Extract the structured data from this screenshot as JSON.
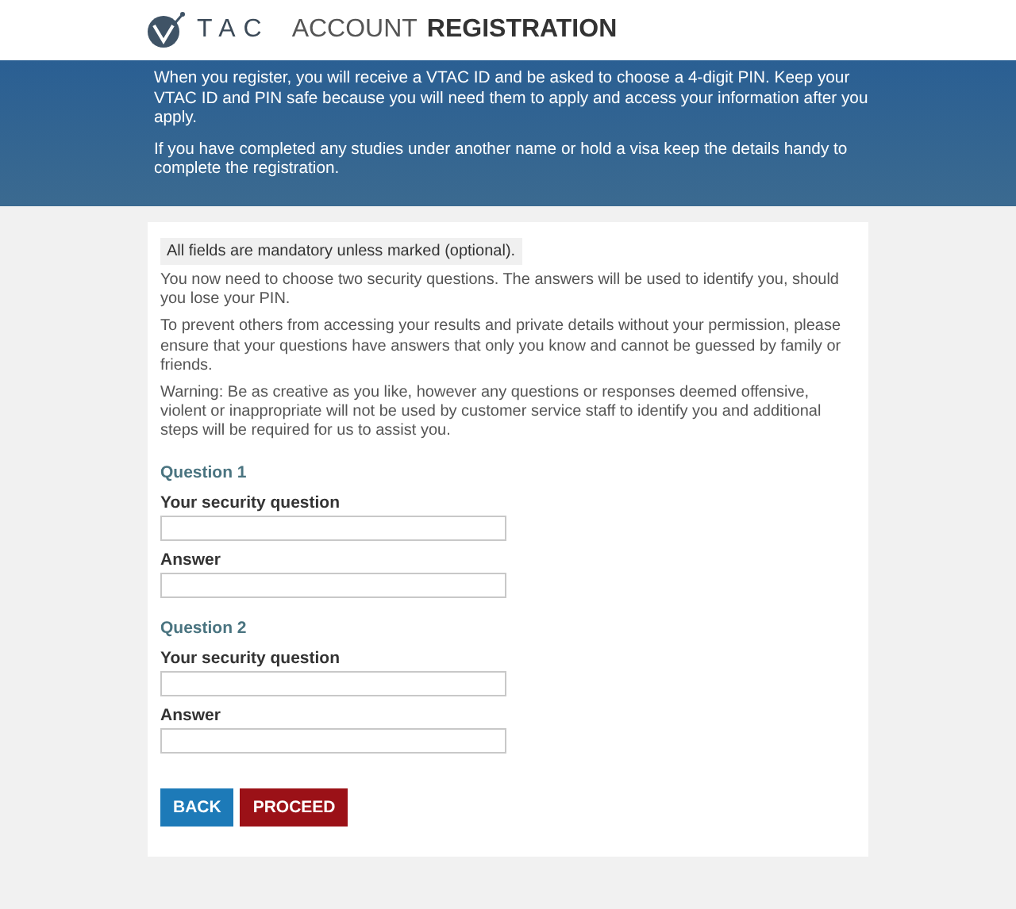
{
  "header": {
    "logo_text": "TAC",
    "title_light": "ACCOUNT",
    "title_bold": "REGISTRATION"
  },
  "banner": {
    "paragraphs": [
      "When you register, you will receive a VTAC ID and be asked to choose a 4-digit PIN. Keep your VTAC ID and PIN safe because you will need them to apply and access your information after you apply.",
      "If you have completed any studies under another name or hold a visa keep the details handy to complete the registration."
    ]
  },
  "form": {
    "notice": "All fields are mandatory unless marked (optional).",
    "paragraphs": [
      "You now need to choose two security questions. The answers will be used to identify you, should you lose your PIN.",
      "To prevent others from accessing your results and private details without your permission, please ensure that your questions have answers that only you know and cannot be guessed by family or friends.",
      "Warning: Be as creative as you like, however any questions or responses deemed offensive, violent or inappropriate will not be used by customer service staff to identify you and additional steps will be required for us to assist you."
    ],
    "questions": [
      {
        "heading": "Question 1",
        "fields": [
          {
            "label": "Your security question"
          },
          {
            "label": "Answer"
          }
        ]
      },
      {
        "heading": "Question 2",
        "fields": [
          {
            "label": "Your security question"
          },
          {
            "label": "Answer"
          }
        ]
      }
    ],
    "buttons": [
      {
        "label": "BACK",
        "kind": "secondary"
      },
      {
        "label": "PROCEED",
        "kind": "primary"
      }
    ]
  }
}
